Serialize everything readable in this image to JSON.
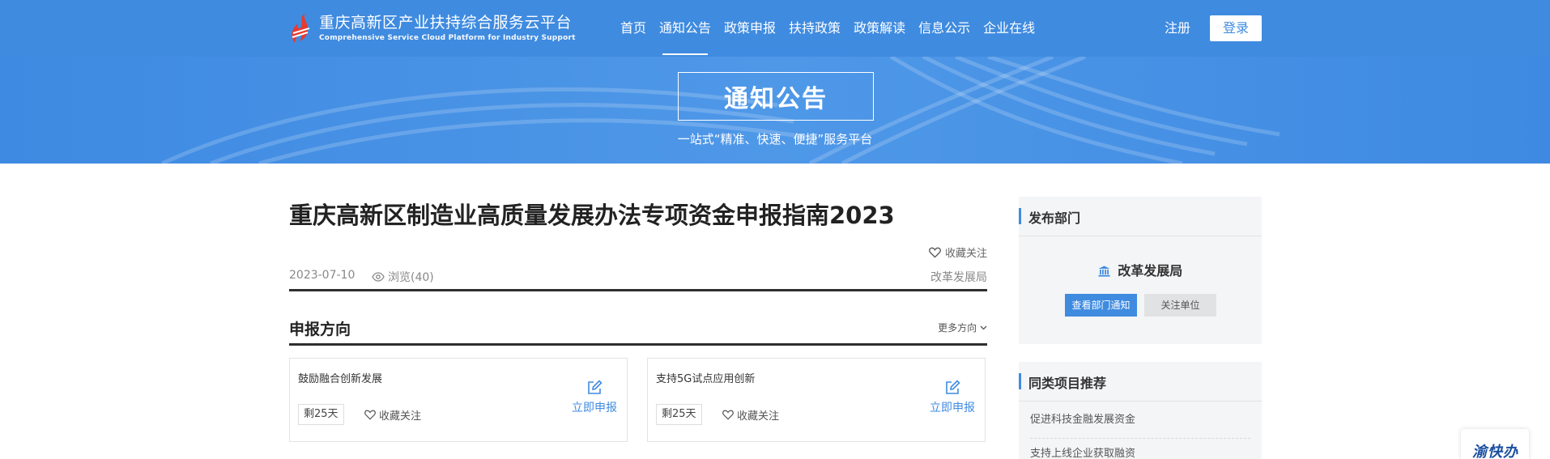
{
  "header": {
    "brand_title": "重庆高新区产业扶持综合服务云平台",
    "brand_subtitle": "Comprehensive Service Cloud Platform for Industry Support",
    "nav": [
      {
        "label": "首页",
        "active": false
      },
      {
        "label": "通知公告",
        "active": true
      },
      {
        "label": "政策申报",
        "active": false
      },
      {
        "label": "扶持政策",
        "active": false
      },
      {
        "label": "政策解读",
        "active": false
      },
      {
        "label": "信息公示",
        "active": false
      },
      {
        "label": "企业在线",
        "active": false
      }
    ],
    "register_label": "注册",
    "login_label": "登录"
  },
  "banner": {
    "title": "通知公告",
    "subtitle": "一站式“精准、快速、便捷”服务平台"
  },
  "article": {
    "title": "重庆高新区制造业高质量发展办法专项资金申报指南2023",
    "favorite_label": "收藏关注",
    "date": "2023-07-10",
    "views": "浏览(40)",
    "department": "改革发展局"
  },
  "section": {
    "title": "申报方向",
    "more_label": "更多方向"
  },
  "cards": [
    {
      "title": "鼓励融合创新发展",
      "tag": "剩25天",
      "favorite_label": "收藏关注",
      "apply_label": "立即申报"
    },
    {
      "title": "支持5G试点应用创新",
      "tag": "剩25天",
      "favorite_label": "收藏关注",
      "apply_label": "立即申报"
    }
  ],
  "sidebar": {
    "publisher_heading": "发布部门",
    "publisher_name": "改革发展局",
    "view_notices_label": "查看部门通知",
    "follow_label": "关注单位",
    "related_heading": "同类项目推荐",
    "related_items": [
      "促进科技金融发展资金",
      "支持上线企业获取融资"
    ]
  },
  "float_badge": {
    "text": "渝快办"
  },
  "colors": {
    "primary": "#3f8be0",
    "dark_text": "#222222",
    "divider": "#2f2f2f",
    "sidebar_bg": "#f4f5f7"
  },
  "icons": [
    "logo-icon",
    "heart-icon",
    "eye-icon",
    "edit-icon",
    "chevron-down-icon",
    "bank-icon"
  ]
}
